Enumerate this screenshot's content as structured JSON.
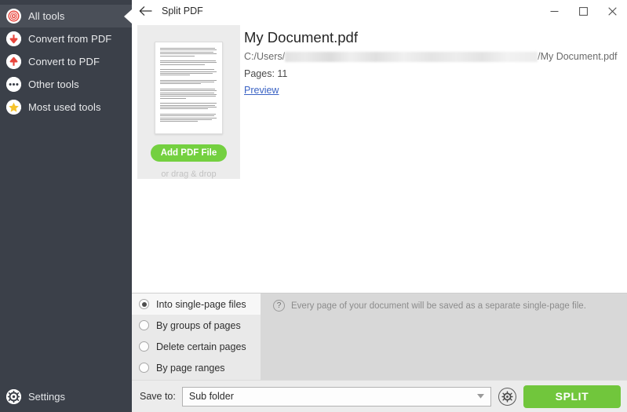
{
  "window": {
    "title": "Split PDF",
    "back_icon": "arrow-left-icon",
    "controls": {
      "minimize": "–",
      "maximize": "☐",
      "close": "✕"
    }
  },
  "sidebar": {
    "items": [
      {
        "label": "All tools",
        "icon": "target-spiral-icon",
        "active": true
      },
      {
        "label": "Convert from PDF",
        "icon": "arrow-down-circle-icon",
        "active": false
      },
      {
        "label": "Convert to PDF",
        "icon": "arrow-up-circle-icon",
        "active": false
      },
      {
        "label": "Other tools",
        "icon": "ellipsis-circle-icon",
        "active": false
      },
      {
        "label": "Most used tools",
        "icon": "star-circle-icon",
        "active": false
      }
    ],
    "settings": {
      "label": "Settings",
      "icon": "gear-circle-icon"
    },
    "background_color": "#3b4049",
    "active_color": "#4a4f58"
  },
  "file_card": {
    "thumbnail_name": "document-page-thumbnail",
    "add_button_label": "Add PDF File",
    "drag_hint": "or drag & drop",
    "add_button_color": "#74d040"
  },
  "file_info": {
    "name": "My Document.pdf",
    "path_prefix": "C:/Users/",
    "path_redacted": true,
    "path_suffix": "/My Document.pdf",
    "pages_label": "Pages: 11",
    "preview_link": "Preview",
    "link_color": "#3b63c4"
  },
  "options": {
    "radios": [
      {
        "label": "Into single-page files",
        "selected": true
      },
      {
        "label": "By groups of pages",
        "selected": false
      },
      {
        "label": "Delete certain pages",
        "selected": false
      },
      {
        "label": "By page ranges",
        "selected": false
      }
    ],
    "hint_icon": "?",
    "hint_text": "Every page of your document will be saved as a separate single-page file."
  },
  "bottom_bar": {
    "save_to_label": "Save to:",
    "save_to_value": "Sub folder",
    "save_to_placeholder": "Sub folder",
    "save_to_options": [
      "Sub folder"
    ],
    "gear_icon": "gear-icon",
    "split_label": "SPLIT",
    "split_color": "#71c63c"
  }
}
